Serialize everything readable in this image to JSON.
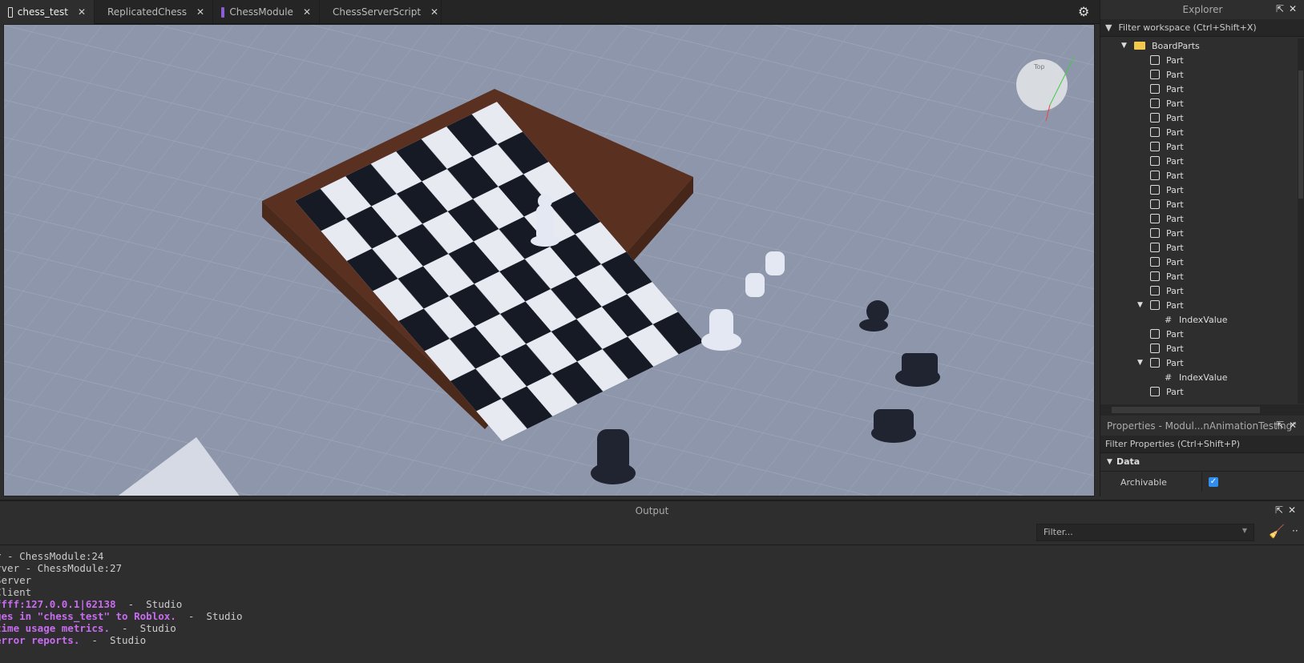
{
  "tabs": [
    {
      "label": "chess_test",
      "icon": "place-icon",
      "active": true
    },
    {
      "label": "ReplicatedChess",
      "icon": "module-script-icon"
    },
    {
      "label": "ChessModule",
      "icon": "module-script-icon"
    },
    {
      "label": "ChessServerScript",
      "icon": "script-icon"
    }
  ],
  "viewport": {
    "viewcube_label": "Top"
  },
  "explorer": {
    "title": "Explorer",
    "filter_placeholder": "Filter workspace (Ctrl+Shift+X)",
    "items": [
      {
        "label": "BoardParts",
        "type": "folder",
        "depth": 0,
        "expanded": true
      },
      {
        "label": "Part",
        "type": "part",
        "depth": 1
      },
      {
        "label": "Part",
        "type": "part",
        "depth": 1
      },
      {
        "label": "Part",
        "type": "part",
        "depth": 1
      },
      {
        "label": "Part",
        "type": "part",
        "depth": 1
      },
      {
        "label": "Part",
        "type": "part",
        "depth": 1
      },
      {
        "label": "Part",
        "type": "part",
        "depth": 1
      },
      {
        "label": "Part",
        "type": "part",
        "depth": 1
      },
      {
        "label": "Part",
        "type": "part",
        "depth": 1
      },
      {
        "label": "Part",
        "type": "part",
        "depth": 1
      },
      {
        "label": "Part",
        "type": "part",
        "depth": 1
      },
      {
        "label": "Part",
        "type": "part",
        "depth": 1
      },
      {
        "label": "Part",
        "type": "part",
        "depth": 1
      },
      {
        "label": "Part",
        "type": "part",
        "depth": 1
      },
      {
        "label": "Part",
        "type": "part",
        "depth": 1
      },
      {
        "label": "Part",
        "type": "part",
        "depth": 1
      },
      {
        "label": "Part",
        "type": "part",
        "depth": 1
      },
      {
        "label": "Part",
        "type": "part",
        "depth": 1
      },
      {
        "label": "Part",
        "type": "part",
        "depth": 1,
        "expanded": true
      },
      {
        "label": "IndexValue",
        "type": "value",
        "depth": 2
      },
      {
        "label": "Part",
        "type": "part",
        "depth": 1
      },
      {
        "label": "Part",
        "type": "part",
        "depth": 1
      },
      {
        "label": "Part",
        "type": "part",
        "depth": 1,
        "expanded": true
      },
      {
        "label": "IndexValue",
        "type": "value",
        "depth": 2
      },
      {
        "label": "Part",
        "type": "part",
        "depth": 1
      }
    ]
  },
  "properties": {
    "title": "Properties - Modul...nAnimationTesting\"",
    "filter_placeholder": "Filter Properties (Ctrl+Shift+P)",
    "category": "Data",
    "rows": [
      {
        "name": "Archivable",
        "checked": true
      }
    ]
  },
  "output": {
    "title": "Output",
    "filter_placeholder": "Filter...",
    "lines": [
      {
        "text": "r - ChessModule:24",
        "kind": "normal"
      },
      {
        "text": "rver - ChessModule:27",
        "kind": "normal"
      },
      {
        "text": "Server",
        "kind": "normal"
      },
      {
        "text": "Client",
        "kind": "normal"
      },
      {
        "text": "ffff:127.0.0.1|62138",
        "source": "  -  Studio",
        "kind": "warn"
      },
      {
        "text": "ges in \"chess_test\" to Roblox.",
        "source": "  -  Studio",
        "kind": "warn"
      },
      {
        "text": "time usage metrics.",
        "source": "  -  Studio",
        "kind": "warn"
      },
      {
        "text": "error reports.",
        "source": "  -  Studio",
        "kind": "warn"
      }
    ]
  }
}
